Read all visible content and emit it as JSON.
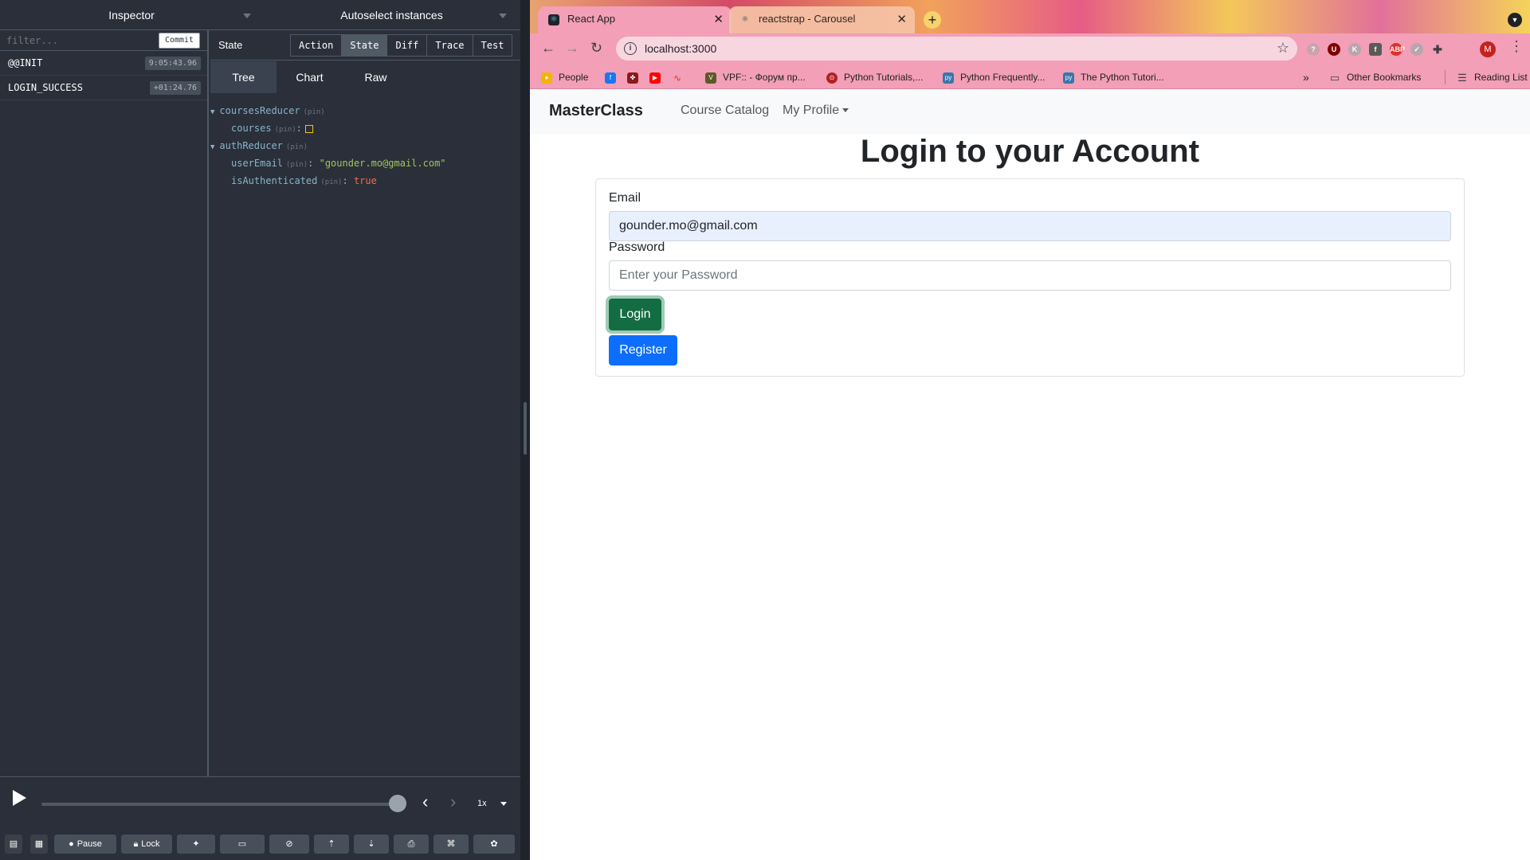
{
  "devtools": {
    "header": {
      "inspector_label": "Inspector",
      "instances_label": "Autoselect instances"
    },
    "filter": {
      "placeholder": "filter...",
      "commit_label": "Commit"
    },
    "actions": [
      {
        "name": "@@INIT",
        "time": "9:05:43.96"
      },
      {
        "name": "LOGIN_SUCCESS",
        "time": "+01:24.76"
      }
    ],
    "state_label": "State",
    "mode_tabs": [
      "Action",
      "State",
      "Diff",
      "Trace",
      "Test"
    ],
    "active_mode": "State",
    "view_tabs": [
      "Tree",
      "Chart",
      "Raw"
    ],
    "active_view": "Tree",
    "tree": {
      "courses_reducer_key": "coursesReducer",
      "courses_key": "courses",
      "auth_reducer_key": "authReducer",
      "user_email_key": "userEmail",
      "user_email_value": "\"gounder.mo@gmail.com\"",
      "is_authenticated_key": "isAuthenticated",
      "is_authenticated_value": "true",
      "pin_label": "(pin)",
      "colon": ":"
    },
    "slider": {
      "speed": "1x",
      "progress": 1.0
    },
    "bottom_buttons": {
      "pause_label": "Pause",
      "lock_label": "Lock"
    }
  },
  "browser": {
    "tabs": [
      {
        "title": "React App",
        "active": true,
        "icon": "react-icon"
      },
      {
        "title": "reactstrap - Carousel",
        "active": false,
        "icon": "reactstrap-icon"
      }
    ],
    "url": "localhost:3000",
    "profile_initial": "M",
    "bookmarks": [
      {
        "label": "People",
        "icon": "people-icon"
      },
      {
        "label": "",
        "icon": "facebook-icon"
      },
      {
        "label": "",
        "icon": "bird-icon"
      },
      {
        "label": "",
        "icon": "youtube-icon"
      },
      {
        "label": "",
        "icon": "scribble-icon"
      },
      {
        "label": "VPF:: - Форум пр...",
        "icon": "vpf-icon"
      },
      {
        "label": "Python Tutorials,...",
        "icon": "python-tutorials-icon"
      },
      {
        "label": "Python Frequently...",
        "icon": "python-icon"
      },
      {
        "label": "The Python Tutori...",
        "icon": "python-icon"
      }
    ],
    "other_bookmarks": "Other Bookmarks",
    "reading_list": "Reading List",
    "colors": {
      "chrome_tab": "#f29fb7",
      "primary": "#0d6efd",
      "success": "#146c43"
    }
  },
  "app": {
    "brand": "MasterClass",
    "nav": {
      "catalog": "Course Catalog",
      "profile": "My Profile"
    },
    "title": "Login to your Account",
    "form": {
      "email_label": "Email",
      "email_value": "gounder.mo@gmail.com",
      "password_label": "Password",
      "password_placeholder": "Enter your Password",
      "login_label": "Login",
      "register_label": "Register"
    }
  }
}
